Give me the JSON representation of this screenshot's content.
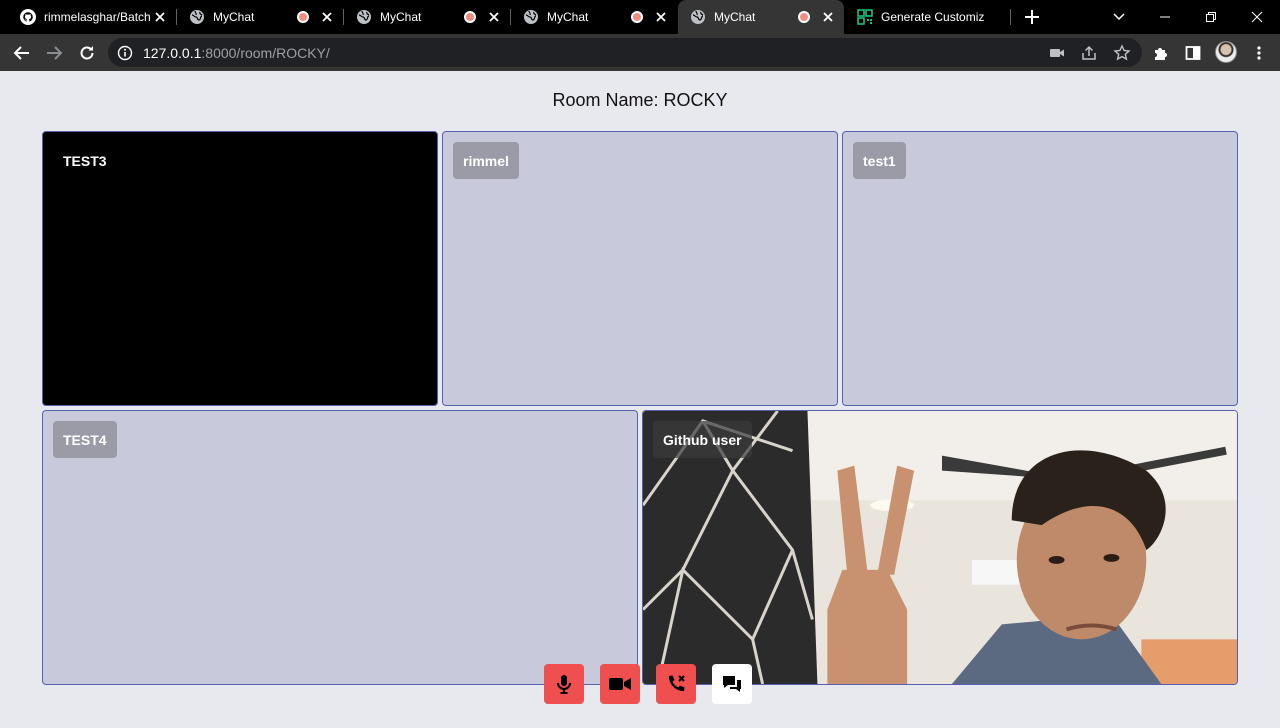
{
  "browser": {
    "tabs": [
      {
        "title": "rimmelasghar/Batch",
        "icon": "github-icon",
        "recording": false,
        "active": false
      },
      {
        "title": "MyChat",
        "icon": "globe-icon",
        "recording": true,
        "active": false
      },
      {
        "title": "MyChat",
        "icon": "globe-icon",
        "recording": true,
        "active": false
      },
      {
        "title": "MyChat",
        "icon": "globe-icon",
        "recording": true,
        "active": false
      },
      {
        "title": "MyChat",
        "icon": "globe-icon",
        "recording": true,
        "active": true
      },
      {
        "title": "Generate Customiz",
        "icon": "qr-icon",
        "recording": false,
        "active": false
      }
    ],
    "url_host": "127.0.0.1",
    "url_path": ":8000/room/ROCKY/"
  },
  "room": {
    "title": "Room Name: ROCKY"
  },
  "participants": [
    {
      "name": "TEST3",
      "state": "camera-off-black"
    },
    {
      "name": "rimmel",
      "state": "no-video"
    },
    {
      "name": "test1",
      "state": "no-video"
    },
    {
      "name": "TEST4",
      "state": "no-video"
    },
    {
      "name": "Github user",
      "state": "live-video"
    }
  ],
  "controls": [
    {
      "name": "microphone",
      "icon": "microphone-icon",
      "color": "#f04f4f"
    },
    {
      "name": "camera",
      "icon": "video-camera-icon",
      "color": "#f04f4f"
    },
    {
      "name": "leave-call",
      "icon": "end-call-icon",
      "color": "#f04f4f"
    },
    {
      "name": "chat",
      "icon": "chat-icon",
      "color": "#ffffff"
    }
  ],
  "colors": {
    "page_bg": "#e8e9ef",
    "tile_bg": "#c8cadb",
    "tile_border": "#5560b0",
    "control_red": "#f04f4f"
  }
}
